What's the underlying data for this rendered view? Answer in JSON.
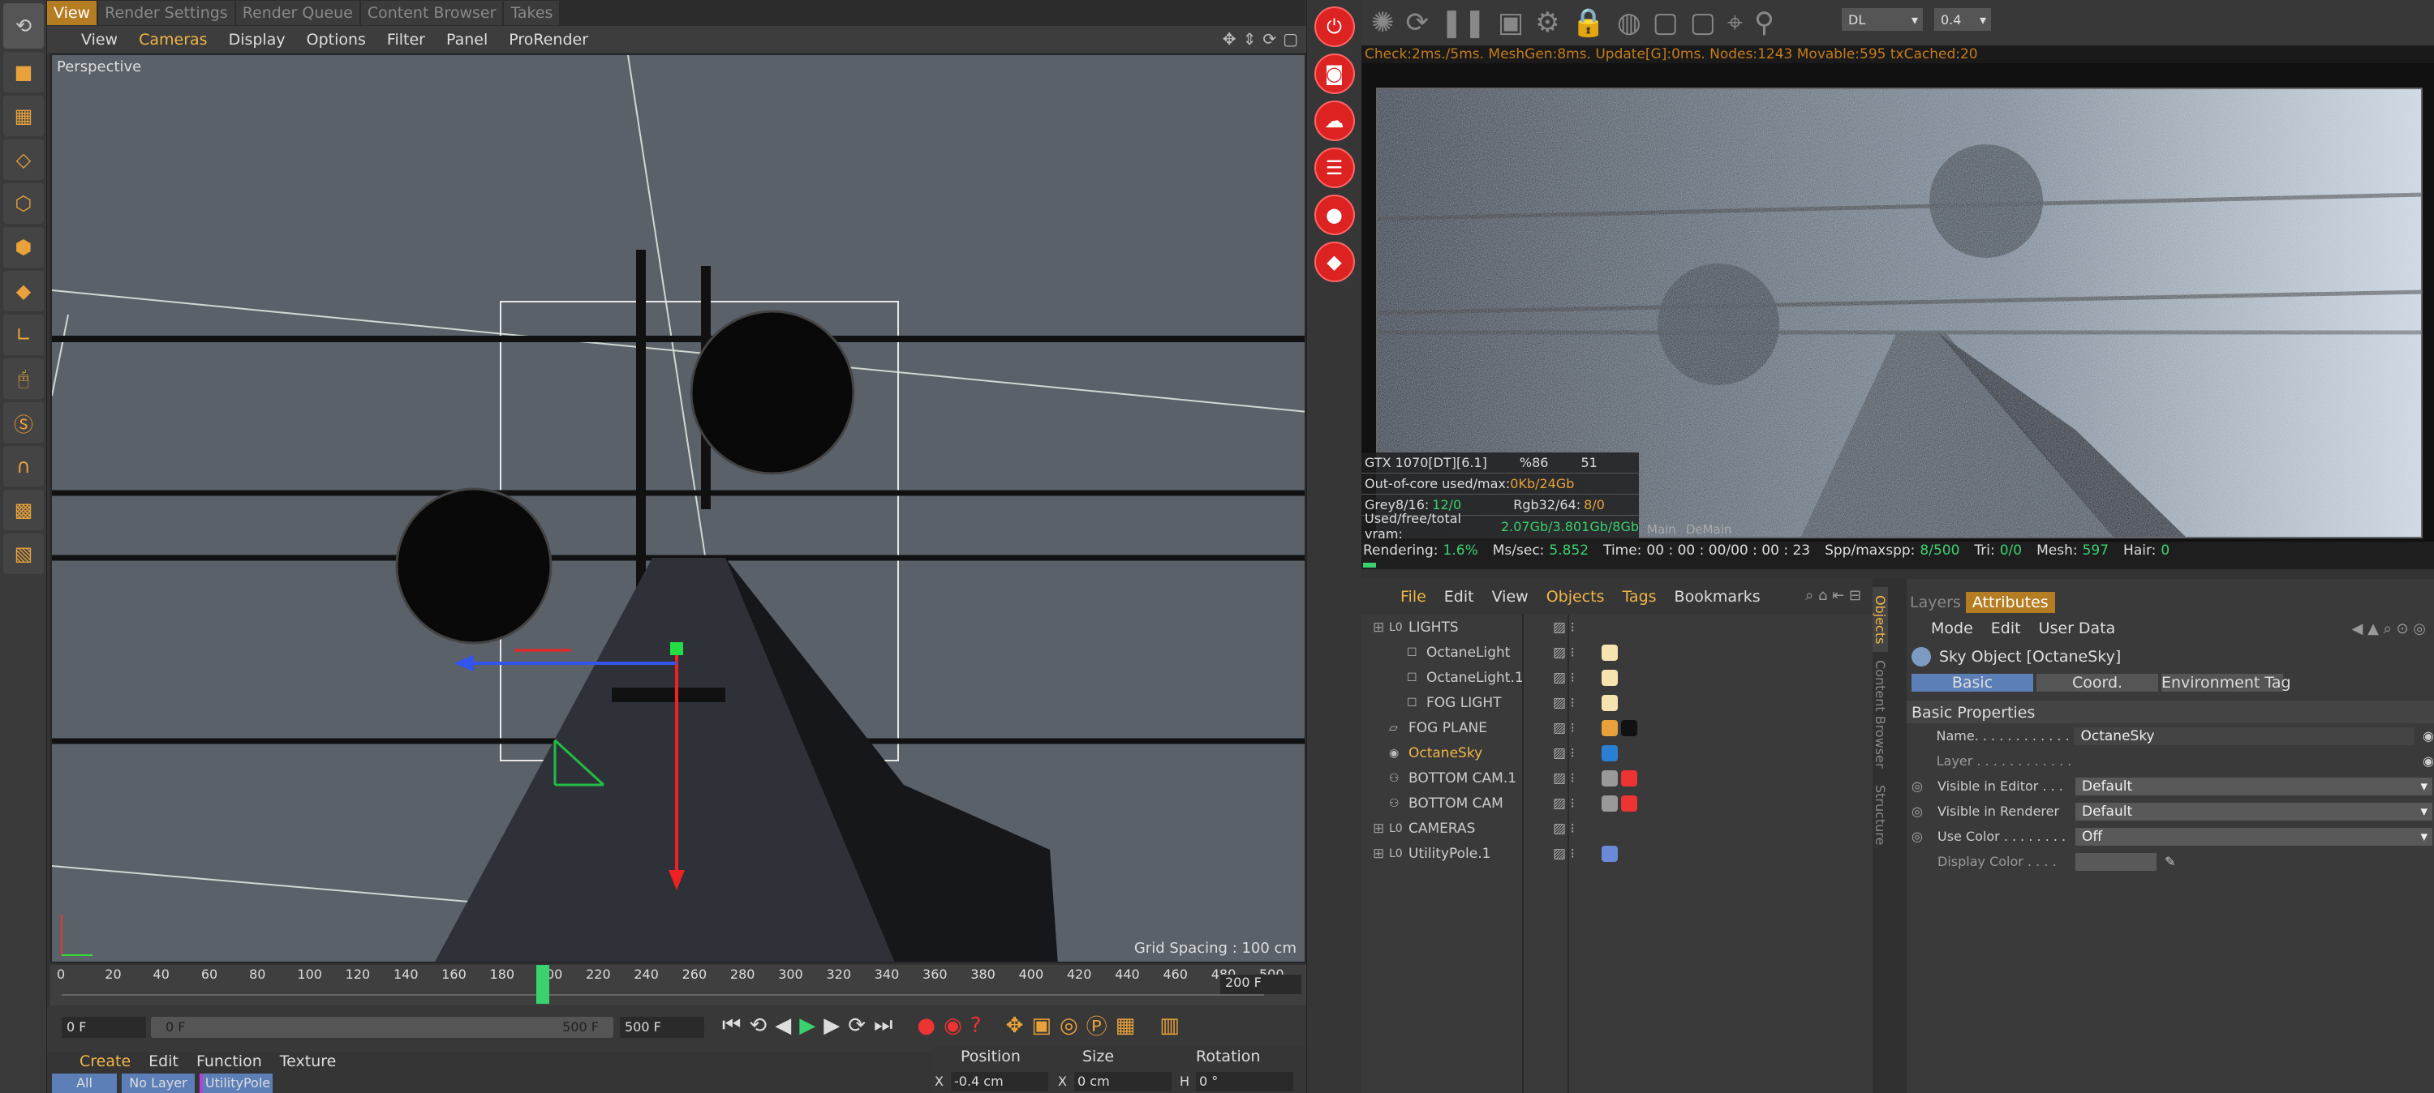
{
  "top_tabs": [
    "View",
    "Render Settings",
    "Render Queue",
    "Content Browser",
    "Takes"
  ],
  "viewport": {
    "menu": [
      "View",
      "Cameras",
      "Display",
      "Options",
      "Filter",
      "Panel",
      "ProRender"
    ],
    "label": "Perspective",
    "grid_spacing": "Grid Spacing : 100 cm"
  },
  "timeline": {
    "ticks": [
      "0",
      "20",
      "40",
      "60",
      "80",
      "100",
      "120",
      "140",
      "160",
      "180",
      "200",
      "220",
      "240",
      "260",
      "280",
      "300",
      "320",
      "340",
      "360",
      "380",
      "400",
      "420",
      "440",
      "460",
      "480",
      "500"
    ],
    "current_frame": "200 F",
    "playhead": 0.4
  },
  "time_controls": {
    "start": "0 F",
    "range_start": "0 F",
    "range_end": "500 F",
    "end": "500 F"
  },
  "material_manager": {
    "menu": [
      "Create",
      "Edit",
      "Function",
      "Texture"
    ],
    "filters": [
      "All",
      "No Layer",
      "UtilityPole"
    ]
  },
  "coordinates": {
    "headers": [
      "Position",
      "Size",
      "Rotation"
    ],
    "row": {
      "pos_label": "X",
      "pos_value": "-0.4 cm",
      "size_label": "X",
      "size_value": "0 cm",
      "rot_label": "H",
      "rot_value": "0 °"
    }
  },
  "live_viewer": {
    "kernel": "DL",
    "value": "0.4",
    "status": "Check:2ms./5ms. MeshGen:8ms. Update[G]:0ms. Nodes:1243 Movable:595 txCached:20",
    "gpu": {
      "name": "GTX 1070[DT][6.1]",
      "pct": "%86",
      "temp": "51"
    },
    "ooc_label": "Out-of-core used/max:",
    "ooc_value": "0Kb/24Gb",
    "grey_label": "Grey8/16:",
    "grey_value": "12/0",
    "rgb_label": "Rgb32/64:",
    "rgb_value": "8/0",
    "vram_label": "Used/free/total vram:",
    "vram_value": "2.07Gb/3.801Gb/8Gb",
    "tabs": [
      "Main",
      "DeMain"
    ],
    "render_label": "Rendering:",
    "render_pct": "1.6%",
    "ms_label": "Ms/sec:",
    "ms_value": "5.852",
    "time_label": "Time:",
    "time_value": "00 : 00 : 00/00 : 00 : 23",
    "spp_label": "Spp/maxspp:",
    "spp_value": "8/500",
    "tri_label": "Tri:",
    "tri_value": "0/0",
    "mesh_label": "Mesh:",
    "mesh_value": "597",
    "hair_label": "Hair:",
    "hair_value": "0"
  },
  "object_manager": {
    "menu": [
      "File",
      "Edit",
      "View",
      "Objects",
      "Tags",
      "Bookmarks"
    ],
    "rows": [
      {
        "name": "LIGHTS",
        "level": 0,
        "icon": "null-icon",
        "tags": []
      },
      {
        "name": "OctaneLight",
        "level": 1,
        "icon": "light-icon",
        "tags": [
          "light-tag-icon"
        ]
      },
      {
        "name": "OctaneLight.1",
        "level": 1,
        "icon": "light-icon",
        "tags": [
          "light-tag-icon"
        ]
      },
      {
        "name": "FOG LIGHT",
        "level": 1,
        "icon": "light-icon",
        "tags": [
          "light-tag-icon"
        ]
      },
      {
        "name": "FOG PLANE",
        "level": 0,
        "icon": "plane-icon",
        "tags": [
          "texture-tag-icon",
          "material-tag-icon"
        ]
      },
      {
        "name": "OctaneSky",
        "level": 0,
        "icon": "sky-icon",
        "tags": [
          "environment-tag-icon"
        ],
        "selected": true
      },
      {
        "name": "BOTTOM CAM.1",
        "level": 0,
        "icon": "camera-icon",
        "tags": [
          "phong-tag-icon",
          "camera-tag-icon"
        ]
      },
      {
        "name": "BOTTOM CAM",
        "level": 0,
        "icon": "camera-icon",
        "tags": [
          "phong-tag-icon",
          "camera-tag-icon"
        ]
      },
      {
        "name": "CAMERAS",
        "level": 0,
        "icon": "null-icon",
        "tags": []
      },
      {
        "name": "UtilityPole.1",
        "level": 0,
        "icon": "null-icon",
        "tags": [
          "polygon-tag-icon"
        ]
      }
    ],
    "side_tabs": [
      "Objects",
      "Content Browser",
      "Structure"
    ]
  },
  "attributes": {
    "tabs": [
      "Layers",
      "Attributes"
    ],
    "menu": [
      "Mode",
      "Edit",
      "User Data"
    ],
    "object_title": "Sky Object [OctaneSky]",
    "subtabs": [
      "Basic",
      "Coord.",
      "Environment Tag"
    ],
    "section": "Basic Properties",
    "fields": [
      {
        "label": "Name. . . . . . . . . . . . .",
        "value": "OctaneSky",
        "type": "text"
      },
      {
        "label": "Layer . . . . . . . . . . . .",
        "value": "",
        "type": "layer"
      },
      {
        "label": "Visible in Editor . . .",
        "value": "Default",
        "type": "select"
      },
      {
        "label": "Visible in Renderer",
        "value": "Default",
        "type": "select"
      },
      {
        "label": "Use Color . . . . . . . .",
        "value": "Off",
        "type": "select"
      },
      {
        "label": "Display Color . . . .",
        "value": "",
        "type": "color"
      }
    ]
  },
  "colors": {
    "accent": "#f0b648",
    "active_tab": "#b57d21",
    "render_red": "#dd2222",
    "viewport_bg": "#5b6169"
  }
}
